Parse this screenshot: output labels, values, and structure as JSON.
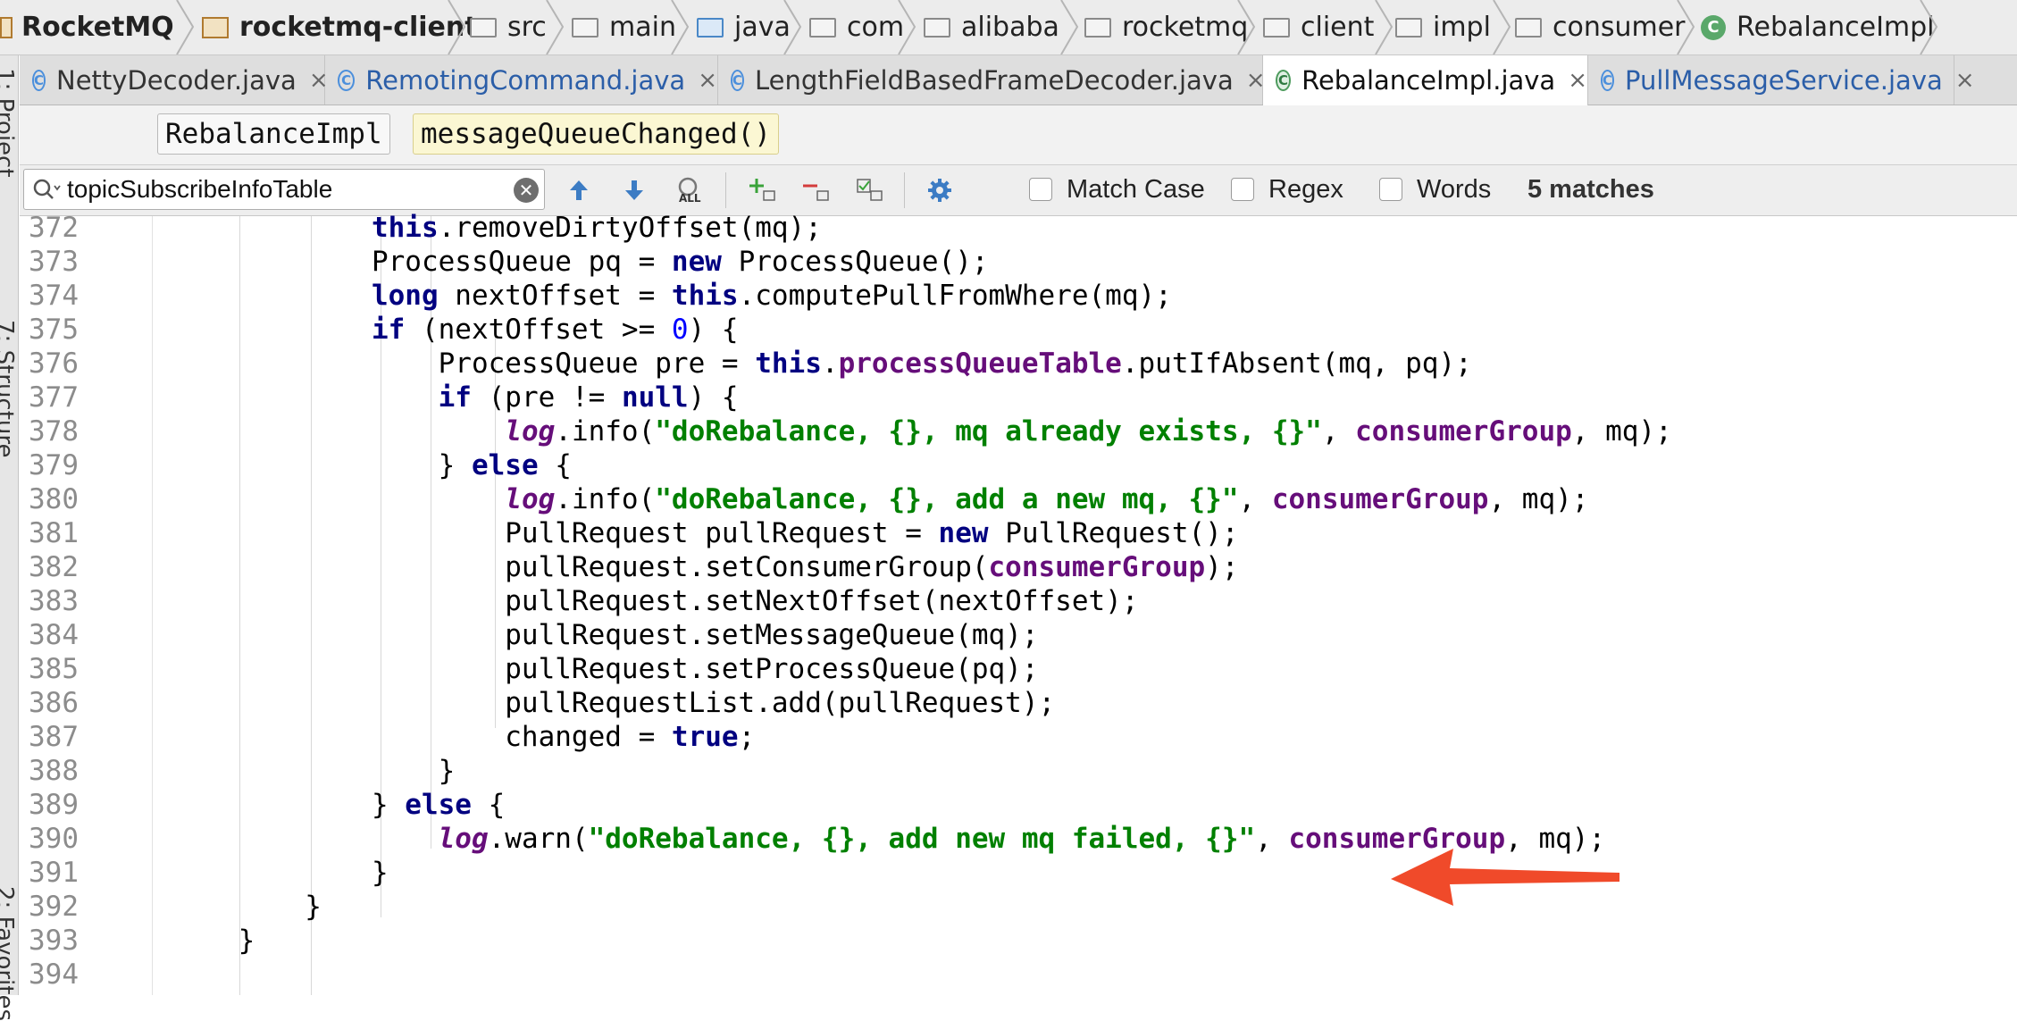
{
  "breadcrumb": [
    "RocketMQ",
    "rocketmq-client",
    "src",
    "main",
    "java",
    "com",
    "alibaba",
    "rocketmq",
    "client",
    "impl",
    "consumer",
    "RebalanceImpl"
  ],
  "tabs": [
    {
      "label": "NettyDecoder.java",
      "close": "×"
    },
    {
      "label": "RemotingCommand.java",
      "close": "×"
    },
    {
      "label": "LengthFieldBasedFrameDecoder.java",
      "close": "×"
    },
    {
      "label": "RebalanceImpl.java",
      "close": "×"
    },
    {
      "label": "PullMessageService.java",
      "close": "×"
    }
  ],
  "side_labels": {
    "project": "1: Project",
    "structure": "7: Structure",
    "favorites": "2: Favorites"
  },
  "method_breadcrumb": {
    "class_name": "RebalanceImpl",
    "method_name": "messageQueueChanged()"
  },
  "find": {
    "query": "topicSubscribeInfoTable",
    "match_case": "Match Case",
    "regex": "Regex",
    "words": "Words",
    "matches": "5 matches",
    "all_label": "ALL"
  },
  "code_lines": [
    {
      "n": "372",
      "tokens": [
        {
          "t": "            "
        },
        {
          "t": "this",
          "c": "kw"
        },
        {
          "t": ".removeDirtyOffset(mq);"
        }
      ]
    },
    {
      "n": "373",
      "tokens": [
        {
          "t": "            ProcessQueue pq = "
        },
        {
          "t": "new",
          "c": "kw"
        },
        {
          "t": " ProcessQueue();"
        }
      ]
    },
    {
      "n": "374",
      "tokens": [
        {
          "t": "            "
        },
        {
          "t": "long",
          "c": "kw"
        },
        {
          "t": " nextOffset = "
        },
        {
          "t": "this",
          "c": "kw"
        },
        {
          "t": ".computePullFromWhere(mq);"
        }
      ]
    },
    {
      "n": "375",
      "tokens": [
        {
          "t": "            "
        },
        {
          "t": "if",
          "c": "kw"
        },
        {
          "t": " (nextOffset >= "
        },
        {
          "t": "0",
          "c": "num"
        },
        {
          "t": ") {"
        }
      ]
    },
    {
      "n": "376",
      "tokens": [
        {
          "t": "                ProcessQueue pre = "
        },
        {
          "t": "this",
          "c": "kw"
        },
        {
          "t": "."
        },
        {
          "t": "processQueueTable",
          "c": "fld"
        },
        {
          "t": ".putIfAbsent(mq, pq);"
        }
      ]
    },
    {
      "n": "377",
      "tokens": [
        {
          "t": "                "
        },
        {
          "t": "if",
          "c": "kw"
        },
        {
          "t": " (pre != "
        },
        {
          "t": "null",
          "c": "kw"
        },
        {
          "t": ") {"
        }
      ]
    },
    {
      "n": "378",
      "tokens": [
        {
          "t": "                    "
        },
        {
          "t": "log",
          "c": "sfld"
        },
        {
          "t": ".info("
        },
        {
          "t": "\"doRebalance, {}, mq already exists, {}\"",
          "c": "str"
        },
        {
          "t": ", "
        },
        {
          "t": "consumerGroup",
          "c": "fld"
        },
        {
          "t": ", mq);"
        }
      ]
    },
    {
      "n": "379",
      "tokens": [
        {
          "t": "                } "
        },
        {
          "t": "else",
          "c": "kw"
        },
        {
          "t": " {"
        }
      ]
    },
    {
      "n": "380",
      "tokens": [
        {
          "t": "                    "
        },
        {
          "t": "log",
          "c": "sfld"
        },
        {
          "t": ".info("
        },
        {
          "t": "\"doRebalance, {}, add a new mq, {}\"",
          "c": "str"
        },
        {
          "t": ", "
        },
        {
          "t": "consumerGroup",
          "c": "fld"
        },
        {
          "t": ", mq);"
        }
      ]
    },
    {
      "n": "381",
      "tokens": [
        {
          "t": "                    PullRequest pullRequest = "
        },
        {
          "t": "new",
          "c": "kw"
        },
        {
          "t": " PullRequest();"
        }
      ]
    },
    {
      "n": "382",
      "tokens": [
        {
          "t": "                    pullRequest.setConsumerGroup("
        },
        {
          "t": "consumerGroup",
          "c": "fld"
        },
        {
          "t": ");"
        }
      ]
    },
    {
      "n": "383",
      "tokens": [
        {
          "t": "                    pullRequest.setNextOffset(nextOffset);"
        }
      ]
    },
    {
      "n": "384",
      "tokens": [
        {
          "t": "                    pullRequest.setMessageQueue(mq);"
        }
      ]
    },
    {
      "n": "385",
      "tokens": [
        {
          "t": "                    pullRequest.setProcessQueue(pq);"
        }
      ]
    },
    {
      "n": "386",
      "tokens": [
        {
          "t": "                    pullRequestList.add(pullRequest);"
        }
      ]
    },
    {
      "n": "387",
      "tokens": [
        {
          "t": "                    changed = "
        },
        {
          "t": "true",
          "c": "kw"
        },
        {
          "t": ";"
        }
      ]
    },
    {
      "n": "388",
      "tokens": [
        {
          "t": "                }"
        }
      ]
    },
    {
      "n": "389",
      "tokens": [
        {
          "t": "            } "
        },
        {
          "t": "else",
          "c": "kw"
        },
        {
          "t": " {"
        }
      ]
    },
    {
      "n": "390",
      "tokens": [
        {
          "t": "                "
        },
        {
          "t": "log",
          "c": "sfld"
        },
        {
          "t": ".warn("
        },
        {
          "t": "\"doRebalance, {}, add new mq failed, {}\"",
          "c": "str"
        },
        {
          "t": ", "
        },
        {
          "t": "consumerGroup",
          "c": "fld"
        },
        {
          "t": ", mq);"
        }
      ]
    },
    {
      "n": "391",
      "tokens": [
        {
          "t": "            }"
        }
      ]
    },
    {
      "n": "392",
      "tokens": [
        {
          "t": "        }"
        }
      ]
    },
    {
      "n": "393",
      "tokens": [
        {
          "t": "    }"
        }
      ]
    },
    {
      "n": "394",
      "tokens": []
    }
  ],
  "colors": {
    "keyword": "#000080",
    "string": "#008000",
    "field": "#660e7a",
    "number": "#0000ff",
    "arrow": "#f04a2a"
  }
}
